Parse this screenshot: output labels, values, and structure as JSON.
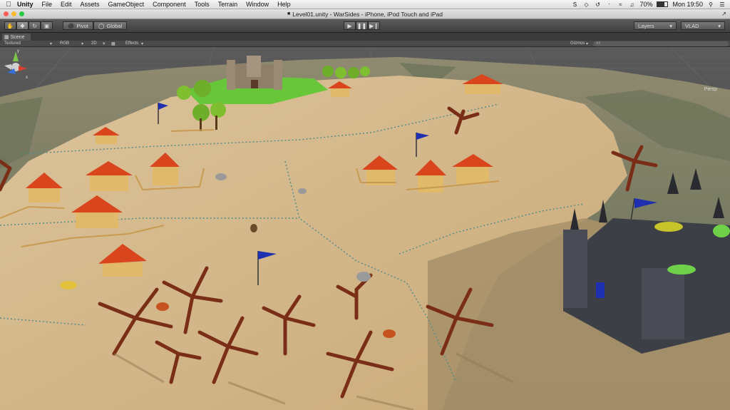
{
  "menubar": {
    "apple": "",
    "items": [
      "Unity",
      "File",
      "Edit",
      "Assets",
      "GameObject",
      "Component",
      "Tools",
      "Terrain",
      "Window",
      "Help"
    ],
    "battery": "70%",
    "clock": "Mon 19:50"
  },
  "window": {
    "title": "Level01.unity - WarSides - iPhone, iPod Touch and iPad"
  },
  "toolbar": {
    "pivot": "Pivot",
    "global": "Global",
    "layers": "Layers",
    "layout": "VLAD"
  },
  "scene": {
    "tab": "Scene",
    "draw_mode": "Textured",
    "color_mode": "RGB",
    "mode_2d": "2D",
    "effects": "Effects",
    "gizmos": "Gizmos",
    "search": "All",
    "projection": "Persp"
  },
  "colors": {
    "ground": "#cfb386",
    "mountain": "#7f7a5e",
    "grass": "#68b53a",
    "roof": "#d9461e",
    "castle_dark": "#3d3f47",
    "tree": "#7a2e17",
    "flag": "#1e2fb0"
  }
}
